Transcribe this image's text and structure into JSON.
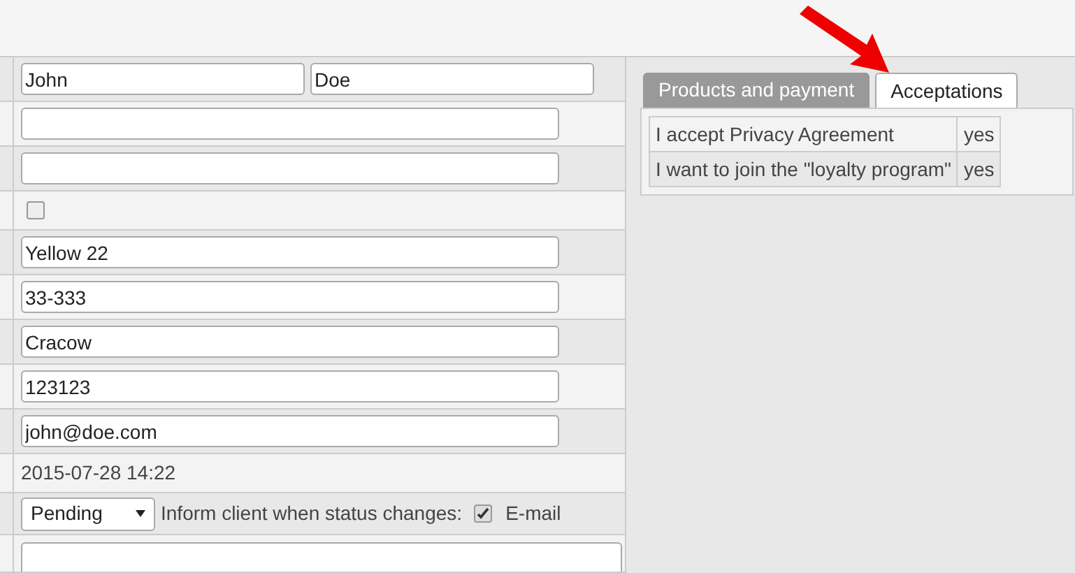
{
  "form_rows": [
    {
      "kind": "name",
      "first": "John",
      "last": "Doe"
    },
    {
      "kind": "input",
      "value": ""
    },
    {
      "kind": "input",
      "value": ""
    },
    {
      "kind": "checkbox",
      "checked": false
    },
    {
      "kind": "input",
      "value": "Yellow 22"
    },
    {
      "kind": "input",
      "value": "33-333"
    },
    {
      "kind": "input",
      "value": "Cracow"
    },
    {
      "kind": "input",
      "value": "123123"
    },
    {
      "kind": "input",
      "value": "john@doe.com"
    },
    {
      "kind": "text",
      "text": "2015-07-28 14:22"
    },
    {
      "kind": "status",
      "status": "Pending",
      "label": "Inform client when status changes:",
      "email_checked": true,
      "email_label": "E-mail"
    },
    {
      "kind": "textarea",
      "value": ""
    }
  ],
  "tabs": [
    {
      "label": "Products and payment",
      "selected": false
    },
    {
      "label": "Acceptations",
      "selected": true
    }
  ],
  "acceptations": [
    {
      "label": "I accept Privacy Agreement",
      "value": "yes"
    },
    {
      "label": "I want to join the \"loyalty program\"",
      "value": "yes"
    }
  ]
}
